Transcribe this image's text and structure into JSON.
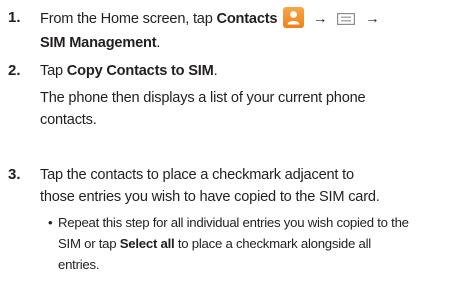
{
  "steps": [
    {
      "number": "1.",
      "lead": "From the Home screen, tap ",
      "contacts_label": "Contacts",
      "arrow": "→",
      "sim_management": "SIM Management",
      "period": ".",
      "icons": {
        "contacts": "contacts-app-icon",
        "menu": "menu-icon"
      }
    },
    {
      "number": "2.",
      "lead": "Tap ",
      "action": "Copy Contacts to SIM",
      "period": ".",
      "result_line1": "The phone then displays a list of your current phone",
      "result_line2": "contacts."
    },
    {
      "number": "3.",
      "line1": "Tap the contacts to place a checkmark adjacent to",
      "line2": "those entries you wish to have copied to the SIM card.",
      "bullet": {
        "dot": "•",
        "line1": "Repeat this step for all individual entries you wish copied to the",
        "line2_lead": "SIM or tap ",
        "select_all": "Select all",
        "line2_tail": " to place a checkmark alongside all",
        "line3": "entries."
      }
    }
  ],
  "colors": {
    "text": "#231f20",
    "icon_orange": "#f39a35"
  }
}
